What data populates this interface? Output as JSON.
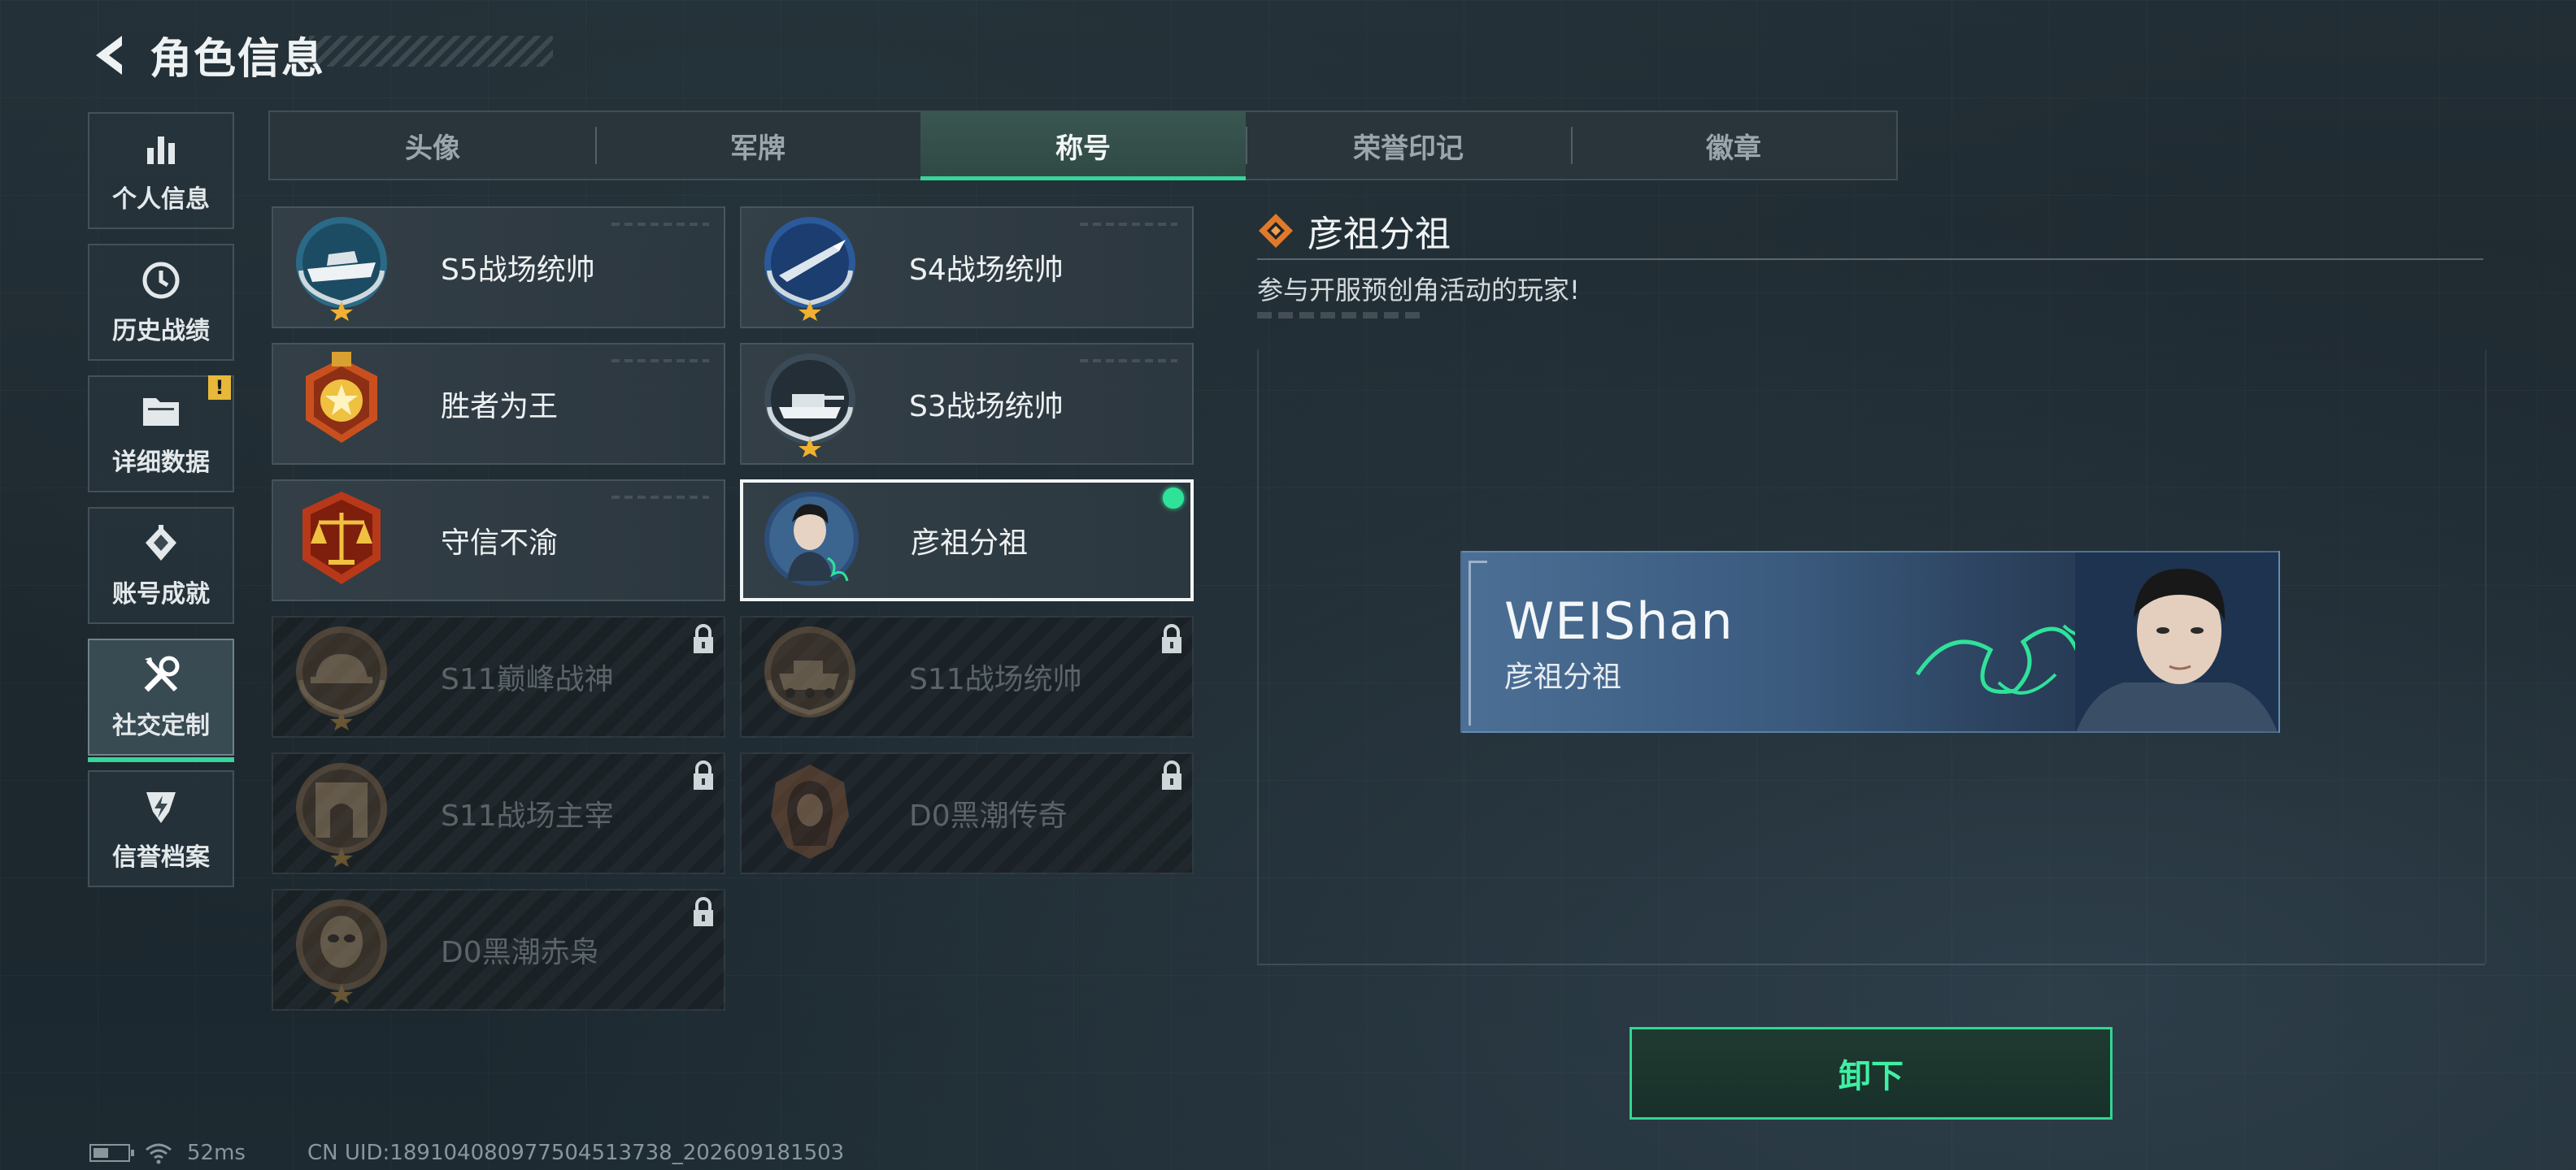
{
  "header": {
    "title": "角色信息"
  },
  "sidebar": {
    "items": [
      {
        "label": "个人信息",
        "icon": "bar-chart-icon"
      },
      {
        "label": "历史战绩",
        "icon": "history-clock-icon"
      },
      {
        "label": "详细数据",
        "icon": "folder-icon",
        "badge": "!"
      },
      {
        "label": "账号成就",
        "icon": "achievement-icon"
      },
      {
        "label": "社交定制",
        "icon": "tools-icon",
        "active": true
      },
      {
        "label": "信誉档案",
        "icon": "shield-lightning-icon"
      }
    ]
  },
  "tabs": [
    {
      "label": "头像"
    },
    {
      "label": "军牌"
    },
    {
      "label": "称号",
      "active": true
    },
    {
      "label": "荣誉印记"
    },
    {
      "label": "徽章"
    }
  ],
  "cards": [
    {
      "title": "S5战场统帅",
      "medal": "boat-medal-icon",
      "locked": false
    },
    {
      "title": "S4战场统帅",
      "medal": "missile-medal-icon",
      "locked": false
    },
    {
      "title": "胜者为王",
      "medal": "gold-star-medal-icon",
      "locked": false
    },
    {
      "title": "S3战场统帅",
      "medal": "tank-medal-icon",
      "locked": false
    },
    {
      "title": "守信不渝",
      "medal": "scales-medal-icon",
      "locked": false
    },
    {
      "title": "彦祖分祖",
      "medal": "portrait-medal-icon",
      "locked": false,
      "selected": true,
      "equipped": true
    },
    {
      "title": "S11巅峰战神",
      "medal": "helmet-medal-icon",
      "locked": true
    },
    {
      "title": "S11战场统帅",
      "medal": "armored-vehicle-medal-icon",
      "locked": true
    },
    {
      "title": "S11战场主宰",
      "medal": "arch-medal-icon",
      "locked": true
    },
    {
      "title": "D0黑潮传奇",
      "medal": "hooded-figure-medal-icon",
      "locked": true
    },
    {
      "title": "D0黑潮赤枭",
      "medal": "masked-figure-medal-icon",
      "locked": true
    }
  ],
  "detail": {
    "title": "彦祖分祖",
    "description": "参与开服预创角活动的玩家!",
    "icon": "diamond-title-icon",
    "nameplate": {
      "player_name": "WEIShan",
      "title": "彦祖分祖"
    },
    "unequip_label": "卸下"
  },
  "status": {
    "ping": "52ms",
    "uid": "CN UID:1891040809775045137​38_202609181503"
  },
  "colors": {
    "accent": "#37d59a",
    "warning": "#e8b838",
    "medal_orange": "#d9632a",
    "nameplate_blue": "#3a5a7e"
  }
}
